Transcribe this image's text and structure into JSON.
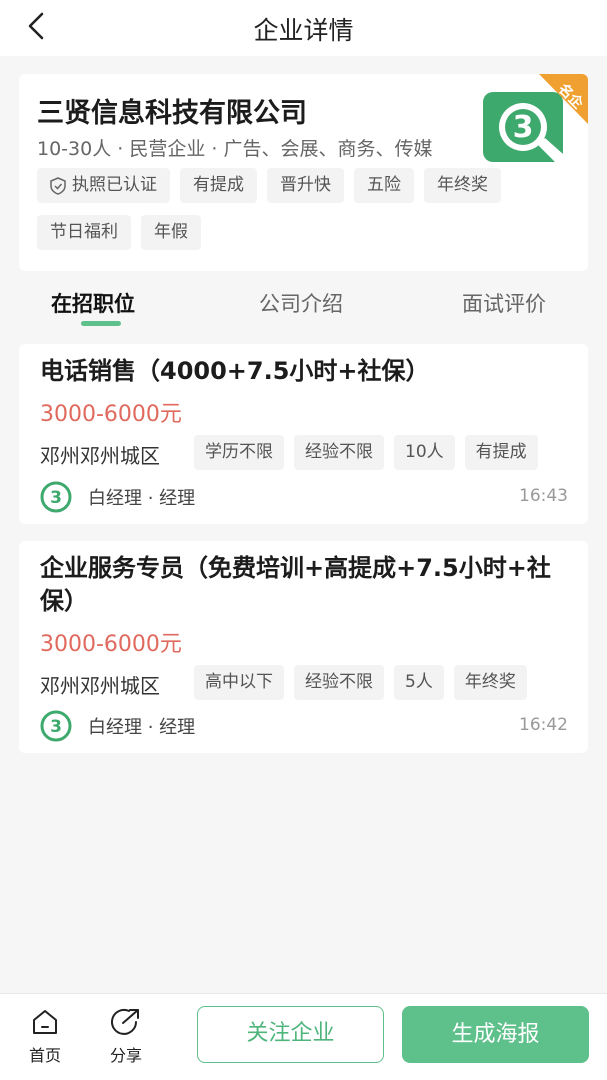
{
  "nav": {
    "title": "企业详情",
    "back_icon": "chevron-left-icon"
  },
  "company": {
    "name": "三贤信息科技有限公司",
    "meta": "10-30人 · 民营企业 · 广告、会展、商务、传媒",
    "badge": "名企",
    "tags": [
      "执照已认证",
      "有提成",
      "晋升快",
      "五险",
      "年终奖",
      "节日福利",
      "年假"
    ],
    "colors": {
      "brand": "#5ec08a",
      "badge": "#f0a030"
    }
  },
  "tabs": [
    {
      "label": "在招职位",
      "active": true
    },
    {
      "label": "公司介绍",
      "active": false
    },
    {
      "label": "面试评价",
      "active": false
    }
  ],
  "jobs": [
    {
      "title": "电话销售（4000+7.5小时+社保）",
      "salary": "3000-6000元",
      "location": "邓州邓州城区",
      "tags": [
        "学历不限",
        "经验不限",
        "10人",
        "有提成"
      ],
      "recruiter": "白经理 · 经理",
      "time": "16:43"
    },
    {
      "title": "企业服务专员（免费培训+高提成+7.5小时+社保）",
      "salary": "3000-6000元",
      "location": "邓州邓州城区",
      "tags": [
        "高中以下",
        "经验不限",
        "5人",
        "年终奖"
      ],
      "recruiter": "白经理 · 经理",
      "time": "16:42"
    }
  ],
  "bottom": {
    "home_label": "首页",
    "share_label": "分享",
    "follow_label": "关注企业",
    "poster_label": "生成海报"
  }
}
